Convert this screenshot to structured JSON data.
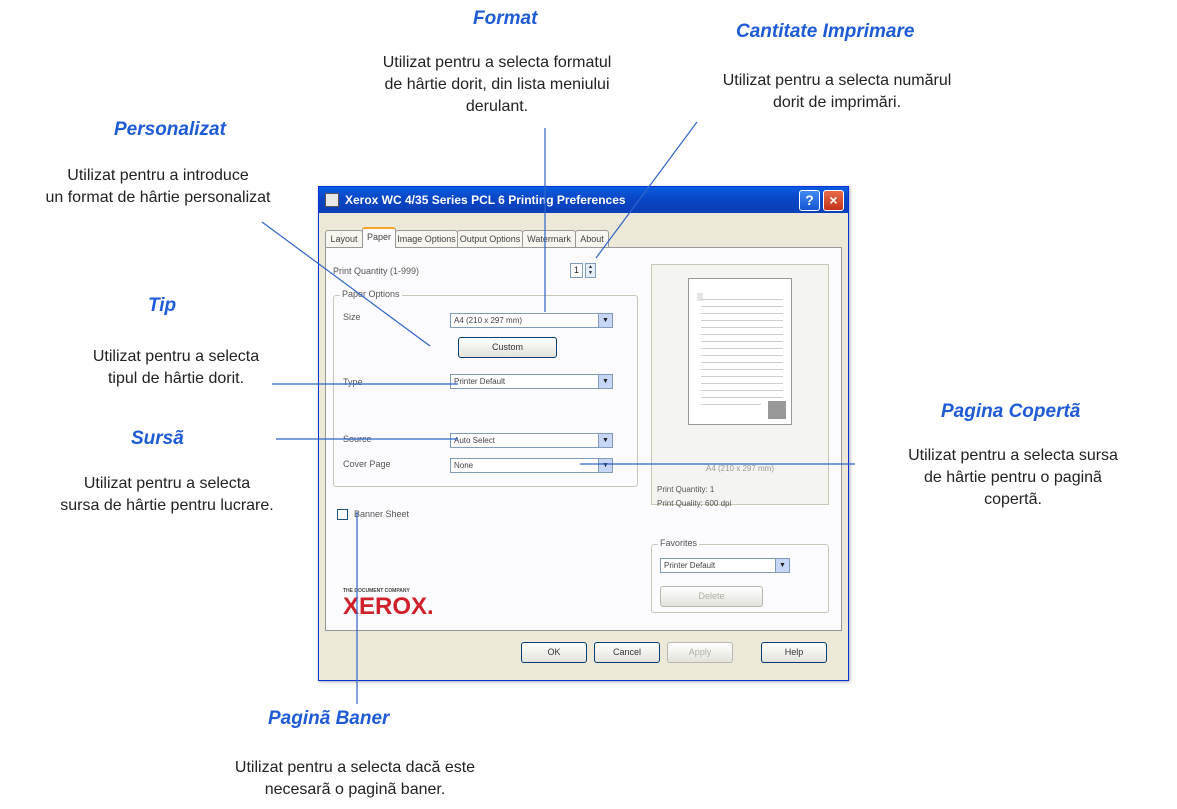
{
  "callouts": {
    "format": {
      "title": "Format",
      "text": "Utilizat pentru a selecta formatul\nde hârtie dorit, din lista meniului\nderulant."
    },
    "quantity": {
      "title": "Cantitate Imprimare",
      "text": "Utilizat pentru a selecta numărul\ndorit de imprimări."
    },
    "custom": {
      "title": "Personalizat",
      "text": "Utilizat pentru a introduce\nun format de hârtie personalizat"
    },
    "type": {
      "title": "Tip",
      "text": "Utilizat pentru a selecta\ntipul de hârtie dorit."
    },
    "source": {
      "title": "Sursã",
      "text": "Utilizat pentru a selecta\nsursa de hârtie pentru lucrare."
    },
    "cover": {
      "title": "Pagina Copertã",
      "text": "Utilizat pentru a selecta sursa\nde hârtie pentru o paginã\ncopertã."
    },
    "banner": {
      "title": "Paginã Baner",
      "text": "Utilizat pentru a selecta dacă este\nnecesarã o paginã baner."
    }
  },
  "dialog": {
    "title": "Xerox WC 4/35 Series PCL 6 Printing Preferences",
    "help_symbol": "?",
    "close_symbol": "×",
    "tabs": [
      "Layout",
      "Paper",
      "Image Options",
      "Output Options",
      "Watermark",
      "About"
    ],
    "active_tab": "Paper",
    "print_quantity_label": "Print Quantity (1-999)",
    "print_quantity_value": "1",
    "paper_options_legend": "Paper Options",
    "size_label": "Size",
    "size_value": "A4 (210 x 297 mm)",
    "custom_button": "Custom",
    "type_label": "Type",
    "type_value": "Printer Default",
    "source_label": "Source",
    "source_value": "Auto Select",
    "cover_label": "Cover Page",
    "cover_value": "None",
    "banner_label": "Banner Sheet",
    "banner_checked": false,
    "preview_caption": "A4 (210 x 297 mm)",
    "preview_quantity": "Print Quantity: 1",
    "preview_quality": "Print Quality: 600 dpi",
    "favorites_legend": "Favorites",
    "favorites_value": "Printer Default",
    "delete_button": "Delete",
    "logo_tagline": "THE DOCUMENT COMPANY",
    "logo_text": "XEROX.",
    "ok_button": "OK",
    "cancel_button": "Cancel",
    "apply_button": "Apply",
    "help_button": "Help"
  },
  "colors": {
    "callout_title": "#1f5bd6",
    "leader_lines": "#2f64c8",
    "titlebar": "#0a5ddf",
    "xerox_red": "#d0202a"
  }
}
